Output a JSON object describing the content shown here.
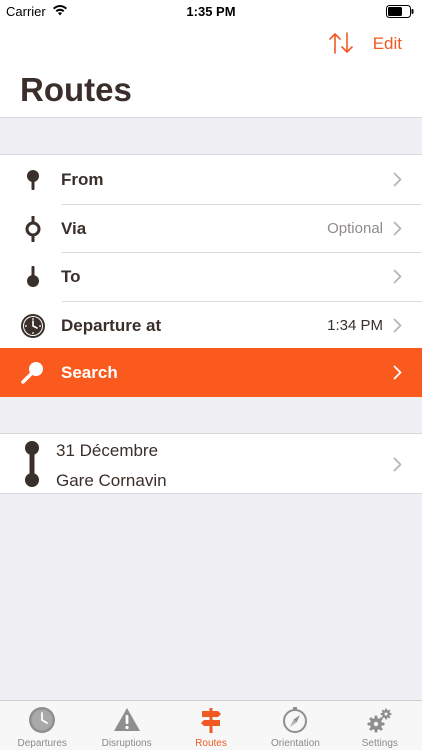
{
  "status_bar": {
    "carrier": "Carrier",
    "time": "1:35 PM"
  },
  "header": {
    "edit_label": "Edit",
    "title": "Routes"
  },
  "form": {
    "from": {
      "label": "From",
      "value": ""
    },
    "via": {
      "label": "Via",
      "value": "Optional"
    },
    "to": {
      "label": "To",
      "value": ""
    },
    "departure": {
      "label": "Departure at",
      "value": "1:34 PM"
    },
    "search": {
      "label": "Search"
    }
  },
  "history": [
    {
      "from": "31 Décembre",
      "to": "Gare Cornavin"
    }
  ],
  "tabbar": {
    "tabs": [
      {
        "label": "Departures",
        "icon": "clock-icon"
      },
      {
        "label": "Disruptions",
        "icon": "warning-icon"
      },
      {
        "label": "Routes",
        "icon": "signpost-icon",
        "active": true
      },
      {
        "label": "Orientation",
        "icon": "compass-icon"
      },
      {
        "label": "Settings",
        "icon": "gears-icon"
      }
    ]
  },
  "colors": {
    "accent": "#f05a22",
    "search_bg": "#fb5a1f",
    "text": "#3a2f2a",
    "background": "#efeff4"
  }
}
